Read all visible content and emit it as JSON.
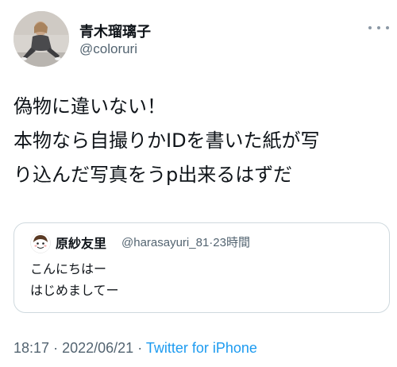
{
  "author": {
    "display_name": "青木瑠璃子",
    "handle": "@coloruri"
  },
  "more_icon": "more-horizontal-icon",
  "tweet": {
    "lines": [
      "偽物に違いない！",
      "本物なら自撮りかIDを書いた紙が写",
      "り込んだ写真をうp出来るはずだ"
    ]
  },
  "quoted": {
    "name": "原紗友里",
    "handle": "@harasayuri_81",
    "separator": "·",
    "time": "23時間",
    "lines": [
      "こんにちはー",
      "はじめましてー"
    ]
  },
  "footer": {
    "time": "18:17",
    "dot1": "·",
    "date": "2022/06/21",
    "dot2": "·",
    "source": "Twitter for iPhone"
  },
  "colors": {
    "text": "#0f1419",
    "secondary": "#536471",
    "link": "#1d9bf0",
    "border": "#cfd9de"
  }
}
